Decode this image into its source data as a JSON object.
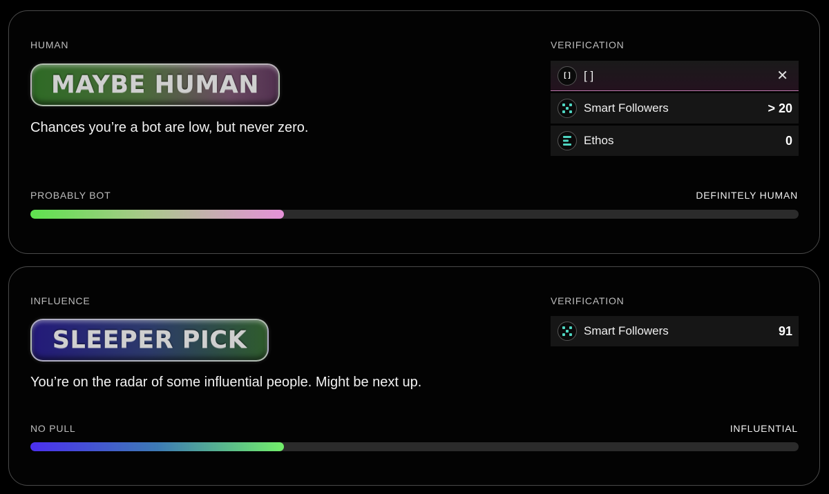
{
  "human_card": {
    "section_label": "HUMAN",
    "badge": "MAYBE HUMAN",
    "description": "Chances you’re a bot are low, but never zero.",
    "verification": {
      "label": "VERIFICATION",
      "header_icon": "[ ]",
      "header_text": "[ ]",
      "close_icon": "✕",
      "rows": [
        {
          "label": "Smart Followers",
          "value": "> 20",
          "icon": "smart-followers-icon"
        },
        {
          "label": "Ethos",
          "value": "0",
          "icon": "ethos-icon"
        }
      ]
    },
    "scale": {
      "left": "PROBABLY BOT",
      "right": "DEFINITELY HUMAN",
      "progress": 0.33
    }
  },
  "influence_card": {
    "section_label": "INFLUENCE",
    "badge": "SLEEPER PICK",
    "description": "You’re on the radar of some influential people. Might be next up.",
    "verification": {
      "label": "VERIFICATION",
      "rows": [
        {
          "label": "Smart Followers",
          "value": "91",
          "icon": "smart-followers-icon"
        }
      ]
    },
    "scale": {
      "left": "NO PULL",
      "right": "INFLUENTIAL",
      "progress": 0.33
    }
  },
  "colors": {
    "human_bar_gradient": [
      "#5ee24e",
      "#e591d8"
    ],
    "influence_bar_gradient": [
      "#4b2ff0",
      "#72ee6a"
    ],
    "icon_accent": "#4fd6c2"
  }
}
